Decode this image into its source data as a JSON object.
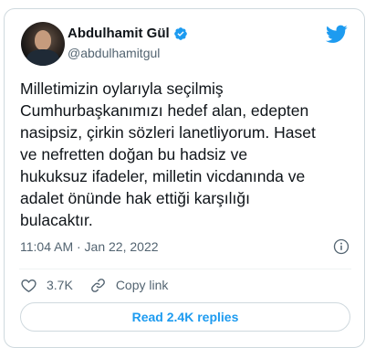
{
  "author": {
    "name": "Abdulhamit Gül",
    "handle": "@abdulhamitgul",
    "verified": true
  },
  "tweet": {
    "text": "Milletimizin oylarıyla seçilmiş\nCumhurbaşkanımızı hedef alan, edepten\nnasipsiz, çirkin sözleri lanetliyorum. Haset\nve nefretten doğan bu hadsiz ve\nhukuksuz ifadeler, milletin vicdanında ve\nadalet önünde hak ettiği karşılığı\nbulacaktır.",
    "timestamp": "11:04 AM · Jan 22, 2022"
  },
  "actions": {
    "like_count": "3.7K",
    "copy_link_label": "Copy link"
  },
  "replies_button": {
    "label": "Read 2.4K replies"
  },
  "icons": {
    "brand": "twitter-bird-icon",
    "verified": "verified-badge-icon",
    "info": "info-icon",
    "like": "heart-icon",
    "link": "link-icon"
  },
  "colors": {
    "accent": "#1d9bf0",
    "text": "#0f1419",
    "secondary": "#536471",
    "border": "#cfd9de"
  }
}
